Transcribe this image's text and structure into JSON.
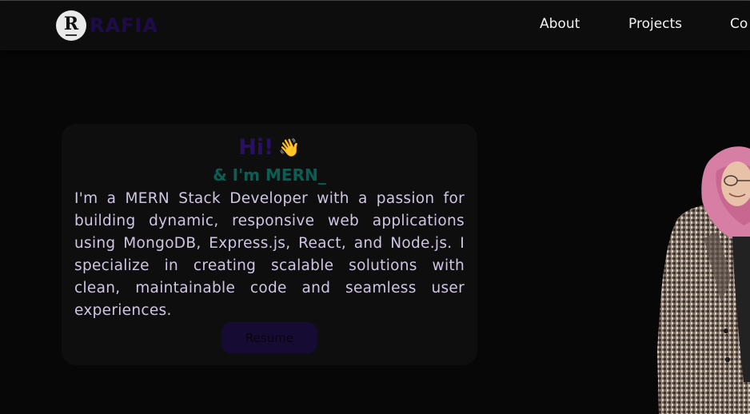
{
  "navbar": {
    "logo_letter": "R",
    "logo_text": "RAFIA",
    "links": [
      {
        "label": "About"
      },
      {
        "label": "Projects"
      },
      {
        "label": "Co"
      }
    ]
  },
  "hero": {
    "greeting": "Hi!",
    "wave_emoji": "👋",
    "role_line": "& I'm MERN_",
    "bio": "I'm a MERN Stack Developer with a passion for building dynamic, responsive web applications using MongoDB, Express.js, React, and Node.js. I specialize in creating scalable solutions with clean, maintainable code and seamless user experiences.",
    "resume_label": "Resume"
  },
  "colors": {
    "background": "#070707",
    "greeting": "#2a0f66",
    "role": "#0c5e55",
    "bio_text": "#cfc6e4",
    "button_bg": "#160b33",
    "logo_text": "#1e0b4a"
  },
  "icons": {
    "logo": "r-badge-icon",
    "greeting": "waving-hand-icon"
  }
}
